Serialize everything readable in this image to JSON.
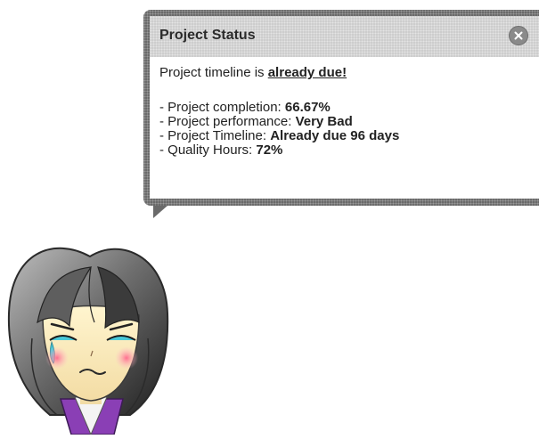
{
  "popup": {
    "title": "Project Status",
    "close_icon": "close-icon",
    "headline_prefix": "Project timeline is ",
    "headline_emphasis": "already due!",
    "items": [
      {
        "label": "- Project completion: ",
        "value": "66.67%"
      },
      {
        "label": "- Project performance: ",
        "value": "Very Bad"
      },
      {
        "label": "- Project Timeline: ",
        "value": "Already due 96 days"
      },
      {
        "label": "- Quality Hours: ",
        "value": "72%"
      }
    ]
  },
  "avatar": {
    "icon": "crying-girl-avatar",
    "colors": {
      "hair": "#6f6f6f",
      "tears": "#48c8d8",
      "blush": "#f5a0b0",
      "shirt": "#8a3fb5"
    }
  }
}
